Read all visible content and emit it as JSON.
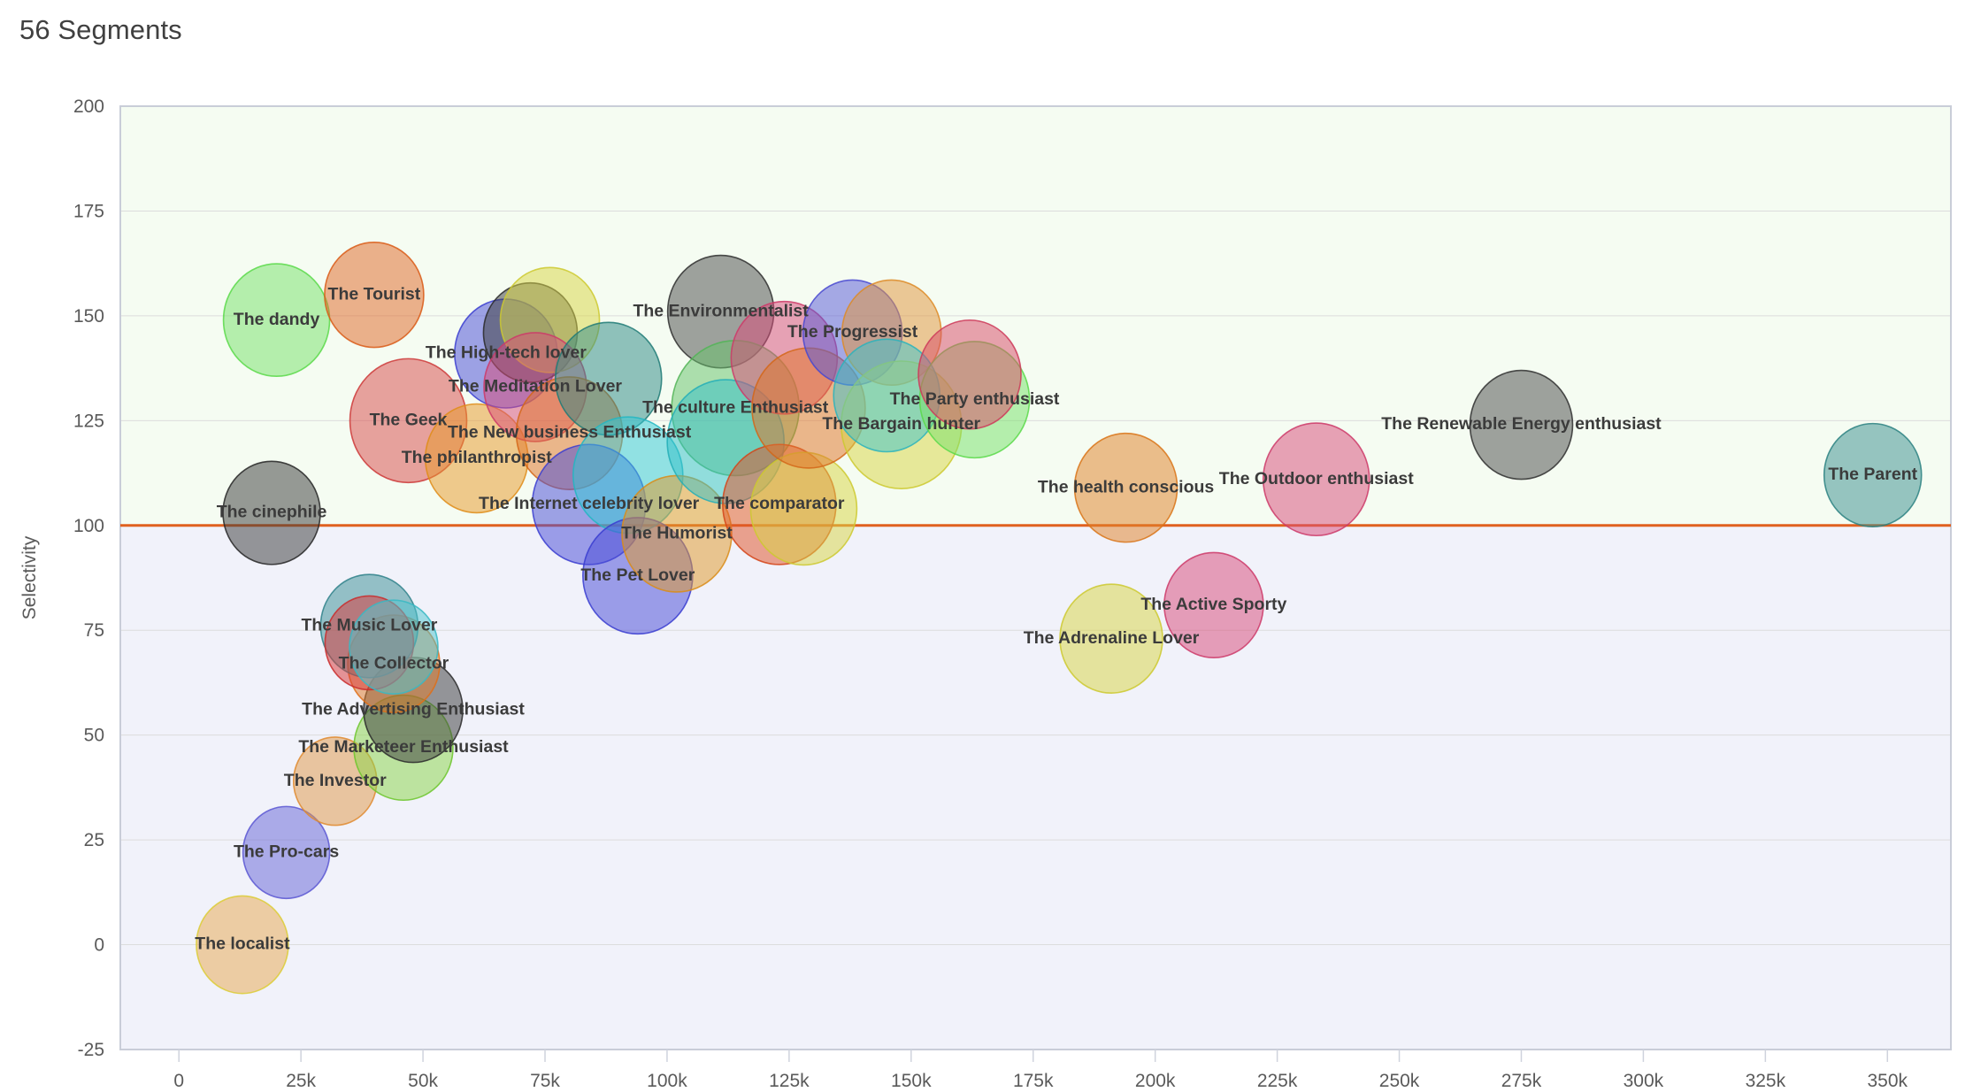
{
  "header": {
    "title": "56 Segments"
  },
  "chart_data": {
    "type": "scatter",
    "title": "56 Segments",
    "xlabel": "",
    "ylabel": "Selectivity",
    "xlim": [
      -12000,
      363000
    ],
    "ylim": [
      -25,
      200
    ],
    "grid": true,
    "legend": "none",
    "x_ticks": [
      0,
      25000,
      50000,
      75000,
      100000,
      125000,
      150000,
      175000,
      200000,
      225000,
      250000,
      275000,
      300000,
      325000,
      350000
    ],
    "x_tick_labels": [
      "0",
      "25k",
      "50k",
      "75k",
      "100k",
      "125k",
      "150k",
      "175k",
      "200k",
      "225k",
      "250k",
      "275k",
      "300k",
      "325k",
      "350k"
    ],
    "y_ticks": [
      -25,
      0,
      25,
      50,
      75,
      100,
      125,
      150,
      175,
      200
    ],
    "y_tick_labels": [
      "-25",
      "0",
      "25",
      "50",
      "75",
      "100",
      "125",
      "150",
      "175",
      "200"
    ],
    "reference_line": {
      "y": 100,
      "color": "#e0601f"
    },
    "band_above_color": "#f5fcf2",
    "band_below_color": "#f1f2fa",
    "bubbles": [
      {
        "label": "The localist",
        "x": 13000,
        "y": 0,
        "r": 52,
        "fill": "#e8a852",
        "stroke": "#dccd36",
        "label_dx": 0,
        "label_dy": 0
      },
      {
        "label": "The Pro-cars",
        "x": 22000,
        "y": 22,
        "r": 49,
        "fill": "#6a68d6",
        "stroke": "#5a57d2",
        "label_dx": 0,
        "label_dy": 0
      },
      {
        "label": "The Investor",
        "x": 32000,
        "y": 39,
        "r": 47,
        "fill": "#e09a4a",
        "stroke": "#df8a2e",
        "label_dx": 0,
        "label_dy": 0
      },
      {
        "label": "The Marketeer Enthusiast",
        "x": 46000,
        "y": 47,
        "r": 56,
        "fill": "#8cd44a",
        "stroke": "#6cc62c",
        "label_dx": 0,
        "label_dy": 0
      },
      {
        "label": "The Advertising Enthusiast",
        "x": 48000,
        "y": 56,
        "r": 56,
        "fill": "#3d3d3d",
        "stroke": "#2a2a2a",
        "label_dx": 0,
        "label_dy": 0
      },
      {
        "label": "The Collector",
        "x": 44000,
        "y": 67,
        "r": 52,
        "fill": "#e07a2a",
        "stroke": "#df6f18",
        "label_dx": 0,
        "label_dy": 0
      },
      {
        "label": "The Music Lover",
        "x": 39000,
        "y": 76,
        "r": 55,
        "fill": "#3d8f96",
        "stroke": "#2f8189",
        "label_dx": 0,
        "label_dy": 0
      },
      {
        "label": "",
        "x": 39000,
        "y": 72,
        "r": 50,
        "fill": "#d83a3a",
        "stroke": "#c92b2b",
        "label_dx": 0,
        "label_dy": 0
      },
      {
        "label": "",
        "x": 44000,
        "y": 71,
        "r": 50,
        "fill": "#53c6cf",
        "stroke": "#38b9c3",
        "label_dx": 0,
        "label_dy": 0
      },
      {
        "label": "The cinephile",
        "x": 19000,
        "y": 103,
        "r": 55,
        "fill": "#3d3d3d",
        "stroke": "#262626",
        "label_dx": 0,
        "label_dy": 0
      },
      {
        "label": "The dandy",
        "x": 20000,
        "y": 149,
        "r": 60,
        "fill": "#79e06b",
        "stroke": "#5ad94a",
        "label_dx": 0,
        "label_dy": 0
      },
      {
        "label": "The Tourist",
        "x": 40000,
        "y": 155,
        "r": 56,
        "fill": "#e06a2a",
        "stroke": "#d95a16",
        "label_dx": 0,
        "label_dy": 0
      },
      {
        "label": "The Geek",
        "x": 47000,
        "y": 125,
        "r": 66,
        "fill": "#d84d4d",
        "stroke": "#cc3838",
        "label_dx": 0,
        "label_dy": 0
      },
      {
        "label": "The philanthropist",
        "x": 61000,
        "y": 116,
        "r": 58,
        "fill": "#e89a2c",
        "stroke": "#df8c18",
        "label_dx": 0,
        "label_dy": 0
      },
      {
        "label": "The High-tech lover",
        "x": 67000,
        "y": 141,
        "r": 58,
        "fill": "#4a4dd6",
        "stroke": "#3a3dd0",
        "label_dx": 0,
        "label_dy": 0
      },
      {
        "label": "",
        "x": 72000,
        "y": 146,
        "r": 53,
        "fill": "#3d3d3d",
        "stroke": "#2a2a2a",
        "label_dx": 0,
        "label_dy": 0
      },
      {
        "label": "",
        "x": 76000,
        "y": 149,
        "r": 56,
        "fill": "#d9d447",
        "stroke": "#cdc92f",
        "label_dx": 0,
        "label_dy": 0
      },
      {
        "label": "The Meditation Lover",
        "x": 73000,
        "y": 133,
        "r": 58,
        "fill": "#d84d7a",
        "stroke": "#cc3a69",
        "label_dx": 0,
        "label_dy": 0
      },
      {
        "label": "The New business Enthusiast",
        "x": 80000,
        "y": 122,
        "r": 60,
        "fill": "#e0742a",
        "stroke": "#d46618",
        "label_dx": 0,
        "label_dy": 0
      },
      {
        "label": "The Internet celebrity lover",
        "x": 84000,
        "y": 105,
        "r": 64,
        "fill": "#4a4dd6",
        "stroke": "#3a3dd0",
        "label_dx": 0,
        "label_dy": 0
      },
      {
        "label": "",
        "x": 88000,
        "y": 135,
        "r": 60,
        "fill": "#2f8a86",
        "stroke": "#1f7a76",
        "label_dx": 0,
        "label_dy": 0
      },
      {
        "label": "",
        "x": 92000,
        "y": 112,
        "r": 62,
        "fill": "#35c8d4",
        "stroke": "#22b6c2",
        "label_dx": 0,
        "label_dy": 0
      },
      {
        "label": "The Pet Lover",
        "x": 94000,
        "y": 88,
        "r": 62,
        "fill": "#4a4dd6",
        "stroke": "#3a3dd0",
        "label_dx": 0,
        "label_dy": 0
      },
      {
        "label": "The Humorist",
        "x": 102000,
        "y": 98,
        "r": 62,
        "fill": "#e09a2c",
        "stroke": "#d98c18",
        "label_dx": 0,
        "label_dy": 0
      },
      {
        "label": "The Environmentalist",
        "x": 111000,
        "y": 151,
        "r": 60,
        "fill": "#4d4d4d",
        "stroke": "#2f2f2f",
        "label_dx": 0,
        "label_dy": 0
      },
      {
        "label": "The culture Enthusiast",
        "x": 114000,
        "y": 128,
        "r": 72,
        "fill": "#67c16b",
        "stroke": "#52b457",
        "label_dx": 0,
        "label_dy": 0
      },
      {
        "label": "",
        "x": 112000,
        "y": 120,
        "r": 66,
        "fill": "#35c0c8",
        "stroke": "#23aeb7",
        "label_dx": 0,
        "label_dy": 0
      },
      {
        "label": "",
        "x": 124000,
        "y": 140,
        "r": 60,
        "fill": "#d84d7a",
        "stroke": "#cc3a69",
        "label_dx": 0,
        "label_dy": 0
      },
      {
        "label": "The comparator",
        "x": 123000,
        "y": 105,
        "r": 64,
        "fill": "#e0542a",
        "stroke": "#d44418",
        "label_dx": 0,
        "label_dy": 0
      },
      {
        "label": "",
        "x": 128000,
        "y": 104,
        "r": 60,
        "fill": "#d9d447",
        "stroke": "#cdc92f",
        "label_dx": 0,
        "label_dy": 0
      },
      {
        "label": "",
        "x": 129000,
        "y": 128,
        "r": 64,
        "fill": "#e0742a",
        "stroke": "#d46618",
        "label_dx": 0,
        "label_dy": 0
      },
      {
        "label": "The Progressist",
        "x": 138000,
        "y": 146,
        "r": 56,
        "fill": "#5a5ad6",
        "stroke": "#4848d0",
        "label_dx": 0,
        "label_dy": 0
      },
      {
        "label": "",
        "x": 146000,
        "y": 146,
        "r": 56,
        "fill": "#e0953f",
        "stroke": "#dd8a26",
        "label_dx": 0,
        "label_dy": 0
      },
      {
        "label": "The Bargain hunter",
        "x": 148000,
        "y": 124,
        "r": 68,
        "fill": "#d9d447",
        "stroke": "#cdc92f",
        "label_dx": 0,
        "label_dy": 0
      },
      {
        "label": "",
        "x": 145000,
        "y": 131,
        "r": 60,
        "fill": "#3fc4cc",
        "stroke": "#2ab3bc",
        "label_dx": 0,
        "label_dy": 0
      },
      {
        "label": "The Party enthusiast",
        "x": 163000,
        "y": 130,
        "r": 62,
        "fill": "#79e06b",
        "stroke": "#5ad94a",
        "label_dx": 0,
        "label_dy": 0
      },
      {
        "label": "",
        "x": 162000,
        "y": 136,
        "r": 58,
        "fill": "#d84d6a",
        "stroke": "#cc3a59",
        "label_dx": 0,
        "label_dy": 0
      },
      {
        "label": "The health conscious",
        "x": 194000,
        "y": 109,
        "r": 58,
        "fill": "#e0822a",
        "stroke": "#d97418",
        "label_dx": 0,
        "label_dy": 0
      },
      {
        "label": "The Adrenaline Lover",
        "x": 191000,
        "y": 73,
        "r": 58,
        "fill": "#d9d447",
        "stroke": "#cdc92f",
        "label_dx": 0,
        "label_dy": 0
      },
      {
        "label": "The Active Sporty",
        "x": 212000,
        "y": 81,
        "r": 56,
        "fill": "#d84d7a",
        "stroke": "#cc3a69",
        "label_dx": 0,
        "label_dy": 0
      },
      {
        "label": "The Outdoor enthusiast",
        "x": 233000,
        "y": 111,
        "r": 60,
        "fill": "#d84d7a",
        "stroke": "#cc3a69",
        "label_dx": 0,
        "label_dy": 0
      },
      {
        "label": "The Renewable Energy enthusiast",
        "x": 275000,
        "y": 124,
        "r": 58,
        "fill": "#4d4d4d",
        "stroke": "#2f2f2f",
        "label_dx": 0,
        "label_dy": 0
      },
      {
        "label": "The Parent",
        "x": 347000,
        "y": 112,
        "r": 55,
        "fill": "#3d8f8f",
        "stroke": "#2b8181",
        "label_dx": 0,
        "label_dy": 0
      }
    ]
  }
}
